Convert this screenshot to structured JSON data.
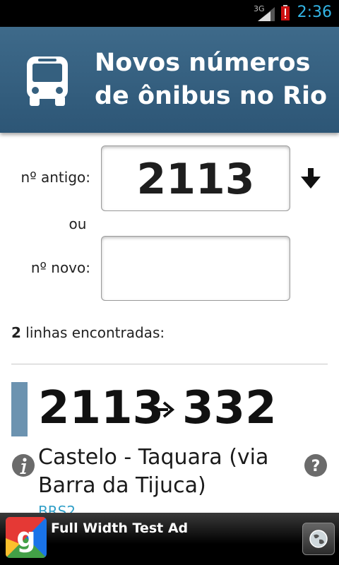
{
  "status_bar": {
    "network": "3G",
    "time": "2:36"
  },
  "header": {
    "title_line1": "Novos números",
    "title_line2": "de ônibus no Rio"
  },
  "form": {
    "old_label": "nº antigo:",
    "old_value": "2113",
    "or_label": "ou",
    "new_label": "nº novo:",
    "new_value": ""
  },
  "results": {
    "count": "2",
    "count_text": " linhas encontradas:",
    "items": [
      {
        "old_number": "2113",
        "new_number": "332",
        "route": "Castelo - Taquara (via Barra da Tijuca)",
        "link": "BRS2"
      }
    ]
  },
  "ad": {
    "text": "Full Width Test Ad"
  },
  "colors": {
    "header": "#35607f",
    "accent_bar": "#6c93b0",
    "link": "#33a0c8",
    "status_time": "#33b5e5"
  }
}
